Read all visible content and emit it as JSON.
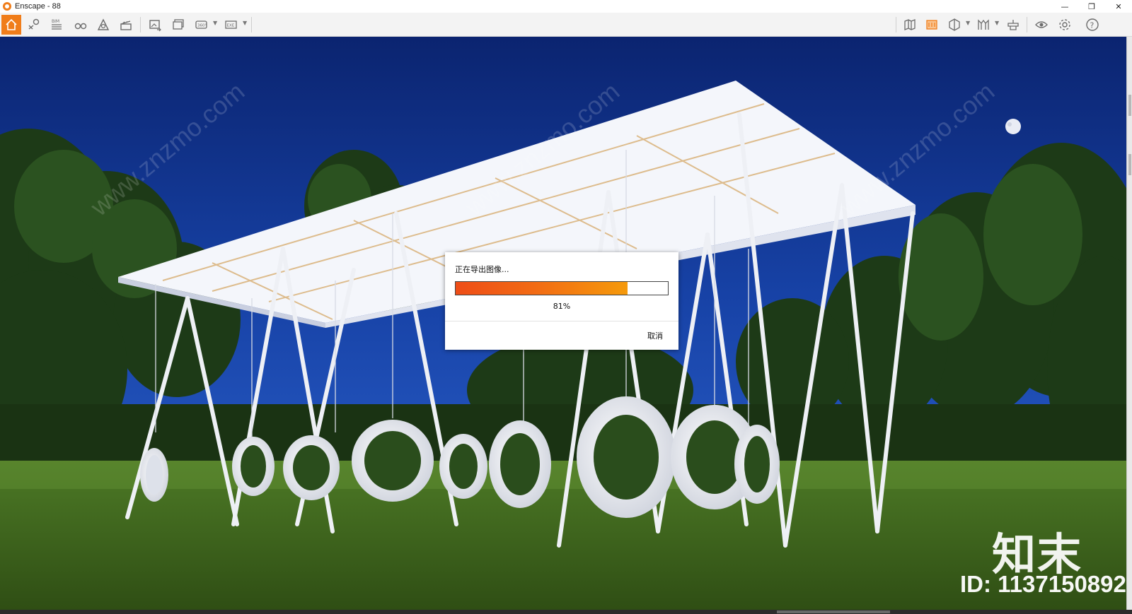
{
  "window": {
    "title": "Enscape - 88"
  },
  "toolbar": {
    "left_buttons": [
      "home-icon",
      "map-pin-icon",
      "bim-icon",
      "binoculars-icon",
      "assets-icon",
      "views-icon"
    ],
    "export_buttons": [
      "render-image-icon",
      "batch-render-icon",
      "panorama-icon",
      "standalone-icon"
    ],
    "right_buttons": [
      "map-icon",
      "timeline-icon",
      "cube-icon",
      "materials-icon",
      "upload-icon",
      "visual-settings-icon",
      "settings-icon",
      "help-icon"
    ],
    "bim_label": "BIM",
    "pano_label": "360°",
    "exe_label": "EXE"
  },
  "dialog": {
    "title": "正在导出图像...",
    "progress_percent": 81,
    "percent_label": "81%",
    "cancel_label": "取消"
  },
  "watermark": {
    "logo_text": "知末",
    "id_text": "ID: 1137150892",
    "diagonal_text": "www.znzmo.com"
  },
  "colors": {
    "accent": "#f07d1a",
    "progress_start": "#ee4d17",
    "progress_end": "#f59a0b"
  }
}
